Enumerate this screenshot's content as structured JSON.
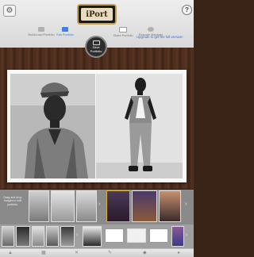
{
  "header": {
    "logo_text": "iPort",
    "upgrade_text": "Upgrade to get the full version!",
    "tabs": [
      {
        "label": "Build/Load Portfolio",
        "active": false
      },
      {
        "label": "Edit Portfolio",
        "active": true
      },
      {
        "label": "Share Portfolio",
        "active": false
      },
      {
        "label": "Resume Manager",
        "active": false
      }
    ],
    "center_button_label": "Save Portfolio"
  },
  "sidebar_hint": "Drag and drop images to edit portfolio.",
  "colors": {
    "accent": "#3a82e8",
    "wood": "#4a2c1c",
    "logo_border": "#c8a24a"
  },
  "bottom_bar_icons": [
    "import-icon",
    "library-icon",
    "tools-icon",
    "edit-icon",
    "tag-icon",
    "next-icon"
  ]
}
